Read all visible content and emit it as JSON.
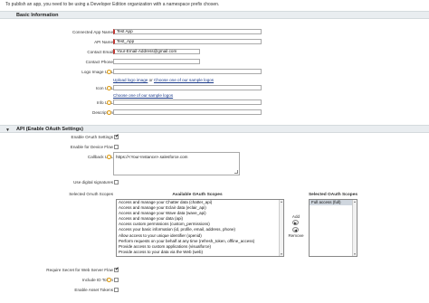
{
  "notice": "To publish an app, you need to be using a Developer Edition organization with a namespace prefix chosen.",
  "sections": {
    "basic": "Basic Information",
    "api": "API (Enable OAuth Settings)"
  },
  "basic_info": {
    "connected_app_name": {
      "label": "Connected App Name",
      "value": "Test App"
    },
    "api_name": {
      "label": "API Name",
      "value": "Test_App"
    },
    "contact_email": {
      "label": "Contact Email",
      "value": "Your-Email-Address@gmail.com"
    },
    "contact_phone": {
      "label": "Contact Phone",
      "value": ""
    },
    "logo_image_url": {
      "label": "Logo Image URL",
      "value": ""
    },
    "upload_logo": "Upload logo image",
    "or": "or",
    "choose_logo": "Choose one of our sample logos",
    "icon_url": {
      "label": "Icon URL",
      "value": ""
    },
    "choose_icon": "Choose one of our sample logos",
    "info_url": {
      "label": "Info URL",
      "value": ""
    },
    "description": {
      "label": "Description",
      "value": ""
    }
  },
  "api_settings": {
    "enable_oauth": {
      "label": "Enable OAuth Settings",
      "checked": true
    },
    "device_flow": {
      "label": "Enable for Device Flow",
      "checked": false
    },
    "callback_url": {
      "label": "Callback URL",
      "value": "https://<Your-Instance>.salesforce.com"
    },
    "digital_signatures": {
      "label": "Use digital signatures",
      "checked": false
    },
    "selected_scopes_label": "Selected OAuth Scopes",
    "available_heading": "Available OAuth Scopes",
    "selected_heading": "Selected OAuth Scopes",
    "available_scopes": [
      "Access and manage your Chatter data (chatter_api)",
      "Access and manage your Eclair data (eclair_api)",
      "Access and manage your Wave data (wave_api)",
      "Access and manage your data (api)",
      "Access custom permissions (custom_permissions)",
      "Access your basic information (id, profile, email, address, phone)",
      "Allow access to your unique identifier (openid)",
      "Perform requests on your behalf at any time (refresh_token, offline_access)",
      "Provide access to custom applications (visualforce)",
      "Provide access to your data via the Web (web)"
    ],
    "selected_scopes": [
      "Full access (full)"
    ],
    "add_label": "Add",
    "remove_label": "Remove",
    "require_secret": {
      "label": "Require Secret for Web Server Flow",
      "checked": true
    },
    "include_id_token": {
      "label": "Include ID Token",
      "checked": false
    },
    "enable_asset_tokens": {
      "label": "Enable Asset Tokens",
      "checked": false
    }
  }
}
